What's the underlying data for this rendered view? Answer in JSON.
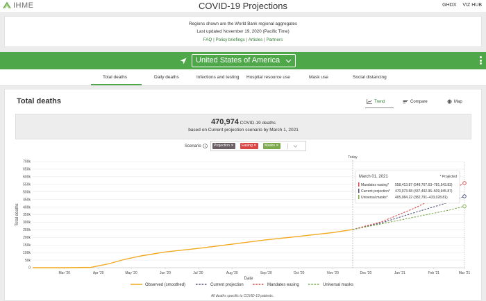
{
  "header": {
    "logo_text": "IHME",
    "title": "COVID-19 Projections",
    "links": [
      "GHDX",
      "VIZ HUB"
    ]
  },
  "info": {
    "line1": "Regions shown are the World Bank regional aggregates",
    "line2": "Last updated November 19, 2020 (Pacific Time)",
    "links": [
      "FAQ",
      "Policy briefings",
      "Articles",
      "Partners"
    ]
  },
  "location": {
    "selected": "United States of America"
  },
  "tabs": [
    "Total deaths",
    "Daily deaths",
    "Infections and testing",
    "Hospital resource use",
    "Mask use",
    "Social distancing"
  ],
  "main": {
    "title": "Total deaths",
    "views": [
      "Trend",
      "Compare",
      "Map"
    ]
  },
  "summary": {
    "value": "470,974",
    "unit": " COVID-19 deaths",
    "subtitle": "based on Current projection scenario by March 1, 2021"
  },
  "scenario": {
    "label": "Scenario",
    "chips": [
      "Projection ✕",
      "Easing ✕",
      "Masks ✕"
    ]
  },
  "colors": {
    "brand_green": "#4ea84a",
    "observed": "#f2a81d",
    "current_projection": "#4b4f77",
    "mandates_easing": "#d94444",
    "universal_masks": "#7aa84a"
  },
  "chart_data": {
    "type": "line",
    "ylabel": "Total deaths",
    "xlabel": "Date",
    "ylim": [
      0,
      700000
    ],
    "y_ticks": [
      0,
      50000,
      100000,
      150000,
      200000,
      250000,
      300000,
      350000,
      400000,
      450000,
      500000,
      550000,
      600000,
      650000,
      700000
    ],
    "y_tick_labels": [
      "0",
      "50k",
      "100k",
      "150k",
      "200k",
      "250k",
      "300k",
      "350k",
      "400k",
      "450k",
      "500k",
      "550k",
      "600k",
      "650k",
      "700k"
    ],
    "x_range": [
      "2020-02-01",
      "2021-03-01"
    ],
    "x_ticks": [
      "2020-03-01",
      "2020-04-01",
      "2020-05-01",
      "2020-06-01",
      "2020-07-01",
      "2020-08-01",
      "2020-09-01",
      "2020-10-01",
      "2020-11-01",
      "2020-12-01",
      "2021-01-01",
      "2021-02-01",
      "2021-03-01"
    ],
    "x_tick_labels": [
      "Mar '20",
      "Apr '20",
      "May '20",
      "Jun '20",
      "Jul '20",
      "Aug '20",
      "Sep '20",
      "Oct '20",
      "Nov '20",
      "Dec '20",
      "Jan '21",
      "Feb '21",
      "Mar '21"
    ],
    "today": {
      "date": "2020-11-19",
      "label": "Today"
    },
    "legend_position": "bottom",
    "series": [
      {
        "name": "Observed (smoothed)",
        "style": "solid",
        "color": "#f2a81d",
        "points": [
          [
            "2020-02-01",
            0
          ],
          [
            "2020-03-01",
            0
          ],
          [
            "2020-03-25",
            2000
          ],
          [
            "2020-04-10",
            25000
          ],
          [
            "2020-04-25",
            55000
          ],
          [
            "2020-05-10",
            78000
          ],
          [
            "2020-06-01",
            104000
          ],
          [
            "2020-07-01",
            127000
          ],
          [
            "2020-08-01",
            155000
          ],
          [
            "2020-09-01",
            184000
          ],
          [
            "2020-10-01",
            207000
          ],
          [
            "2020-11-01",
            232000
          ],
          [
            "2020-11-19",
            252000
          ]
        ]
      },
      {
        "name": "Current projection",
        "style": "dashed",
        "color": "#4b4f77",
        "points": [
          [
            "2020-11-19",
            252000
          ],
          [
            "2020-12-15",
            295000
          ],
          [
            "2021-01-15",
            365000
          ],
          [
            "2021-02-15",
            432000
          ],
          [
            "2021-03-01",
            470974
          ]
        ]
      },
      {
        "name": "Mandates easing",
        "style": "dashed",
        "color": "#d94444",
        "points": [
          [
            "2020-11-19",
            252000
          ],
          [
            "2020-12-15",
            302000
          ],
          [
            "2021-01-15",
            395000
          ],
          [
            "2021-02-15",
            505000
          ],
          [
            "2021-03-01",
            558414
          ]
        ]
      },
      {
        "name": "Universal masks",
        "style": "dashed",
        "color": "#7aa84a",
        "points": [
          [
            "2020-11-19",
            252000
          ],
          [
            "2020-12-15",
            289000
          ],
          [
            "2021-01-15",
            335000
          ],
          [
            "2021-02-15",
            380000
          ],
          [
            "2021-03-01",
            405084
          ]
        ]
      }
    ],
    "tooltip": {
      "date": "March 01, 2021",
      "note": "* Projected",
      "rows": [
        {
          "label": "Mandates easing*",
          "value": "558,413.87 (548,767.63–781,543.83)",
          "color": "#d94444"
        },
        {
          "label": "Current projection*",
          "value": "470,973.58 (437,492.96–509,945.87)",
          "color": "#4b4f77"
        },
        {
          "label": "Universal masks*",
          "value": "405,084.22 (382,791–433,028.81)",
          "color": "#7aa84a"
        }
      ]
    },
    "footnote": "All deaths specific to COVID-19 patients."
  }
}
